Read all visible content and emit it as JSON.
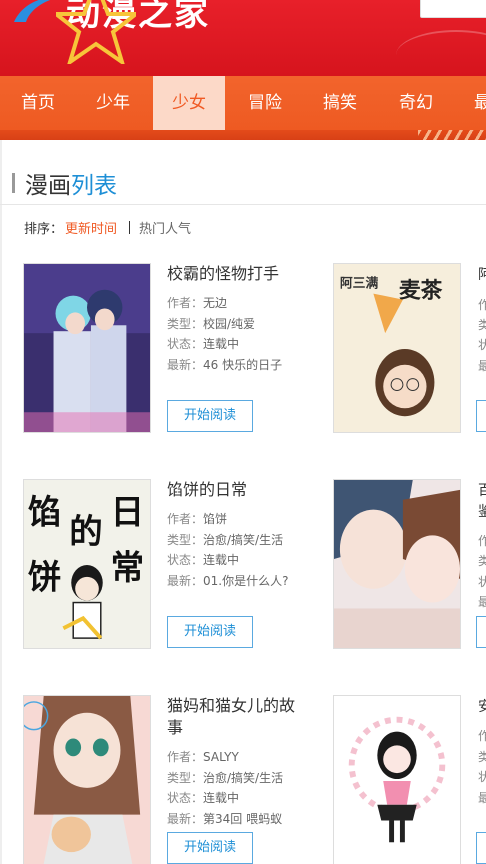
{
  "header": {
    "logo_text": "动漫之家",
    "colors": {
      "brand_red": "#d6141d",
      "nav_orange": "#ee5a22",
      "active_tab_bg": "#fcd9c8",
      "accent_blue": "#1e8fd6",
      "accent_orange": "#f05a24"
    }
  },
  "nav": {
    "items": [
      {
        "label": "首页"
      },
      {
        "label": "少年"
      },
      {
        "label": "少女",
        "active": true
      },
      {
        "label": "冒险"
      },
      {
        "label": "搞笑"
      },
      {
        "label": "奇幻"
      },
      {
        "label": "最"
      }
    ]
  },
  "section": {
    "title_part1": "漫画",
    "title_part2": "列表"
  },
  "sort": {
    "label": "排序：",
    "active": "更新时间",
    "option": "热门人气"
  },
  "labels": {
    "author": "作者：",
    "type": "类型：",
    "status": "状态：",
    "latest": "最新：",
    "read_button": "开始阅读"
  },
  "comics": [
    {
      "title": "校霸的怪物打手",
      "author": "无边",
      "type": "校园/纯爱",
      "status": "连载中",
      "latest": "46 快乐的日子"
    },
    {
      "title": "馅饼的日常",
      "author": "馅饼",
      "type": "治愈/搞笑/生活",
      "status": "连载中",
      "latest": "01.你是什么人?",
      "cover_text": [
        "馅",
        "的",
        "日",
        "饼",
        "常"
      ]
    },
    {
      "title": "猫妈和猫女儿的故事",
      "author": "SALYY",
      "type": "治愈/搞笑/生活",
      "status": "连载中",
      "latest": "第34回 喂蚂蚁"
    }
  ],
  "right_column": [
    {
      "title_clip": "阿",
      "cover_text": [
        "阿三满",
        "麦茶"
      ],
      "meta_clip": [
        "作",
        "类",
        "状",
        "最"
      ]
    },
    {
      "title_clip": "百",
      "title_clip2": "鉴",
      "meta_clip": [
        "作",
        "类",
        "状",
        "最"
      ]
    },
    {
      "title_clip": "安",
      "meta_clip": [
        "作",
        "类",
        "状",
        "最"
      ]
    }
  ]
}
